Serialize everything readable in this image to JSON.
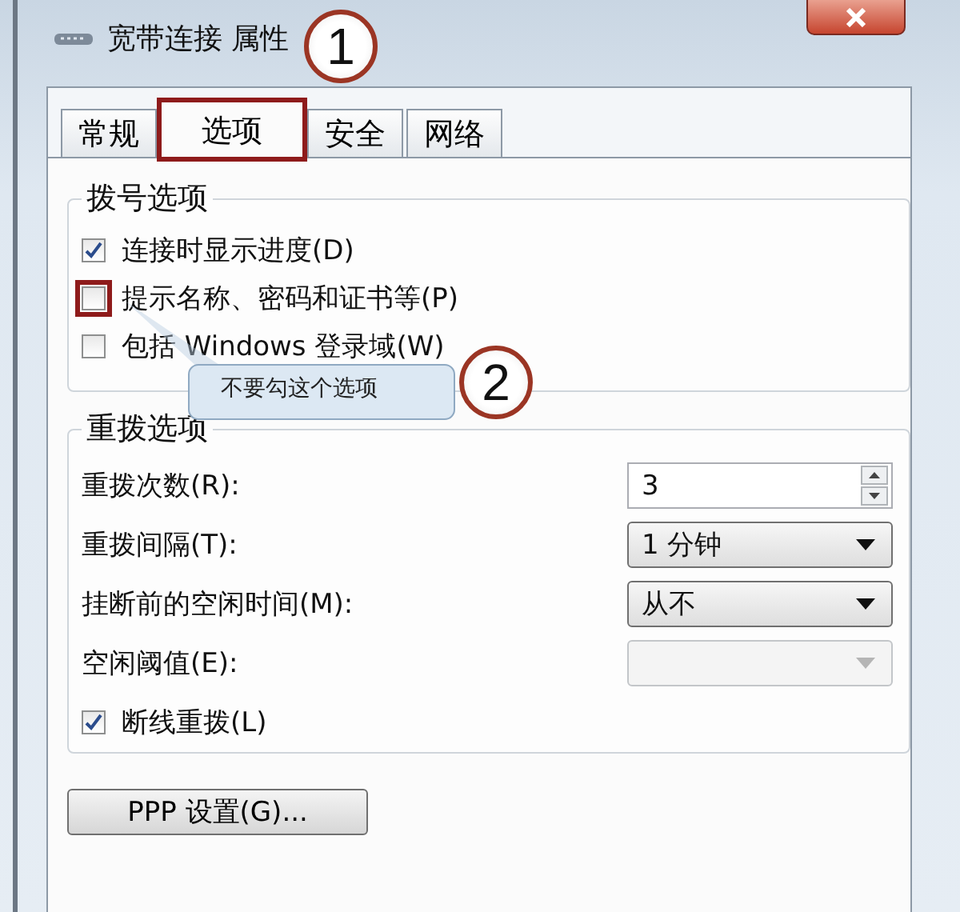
{
  "window": {
    "title": "宽带连接 属性"
  },
  "annotations": [
    "1",
    "2"
  ],
  "tabs": [
    {
      "label": "常规",
      "selected": false,
      "highlighted": false
    },
    {
      "label": "选项",
      "selected": true,
      "highlighted": true
    },
    {
      "label": "安全",
      "selected": false,
      "highlighted": false
    },
    {
      "label": "网络",
      "selected": false,
      "highlighted": false
    }
  ],
  "dialing_options": {
    "title": "拨号选项",
    "checkboxes": [
      {
        "label": "连接时显示进度(D)",
        "checked": true,
        "highlighted": false
      },
      {
        "label": "提示名称、密码和证书等(P)",
        "checked": false,
        "highlighted": true
      },
      {
        "label": "包括 Windows 登录域(W)",
        "checked": false,
        "highlighted": false
      }
    ]
  },
  "callout": {
    "text": "不要勾这个选项"
  },
  "redial_options": {
    "title": "重拨选项",
    "fields": [
      {
        "kind": "spinner",
        "label": "重拨次数(R):",
        "value": "3",
        "disabled": false
      },
      {
        "kind": "dropdown",
        "label": "重拨间隔(T):",
        "value": "1 分钟",
        "disabled": false
      },
      {
        "kind": "dropdown",
        "label": "挂断前的空闲时间(M):",
        "value": "从不",
        "disabled": false
      },
      {
        "kind": "dropdown",
        "label": "空闲阈值(E):",
        "disabled": true
      }
    ],
    "checkbox": {
      "label": "断线重拨(L)",
      "checked": true
    }
  },
  "buttons": [
    "PPP 设置(G)..."
  ]
}
